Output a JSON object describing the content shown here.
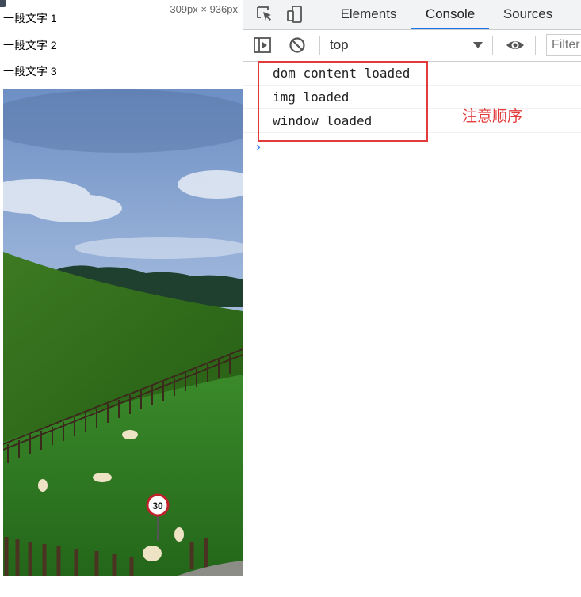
{
  "page": {
    "paragraphs": [
      "一段文字 1",
      "一段文字 2",
      "一段文字 3"
    ],
    "dimensions": "309px × 936px"
  },
  "devtools": {
    "tabs": [
      {
        "label": "Elements",
        "active": false
      },
      {
        "label": "Console",
        "active": true
      },
      {
        "label": "Sources",
        "active": false
      }
    ],
    "context_selector": "top",
    "filter_placeholder": "Filter"
  },
  "console": {
    "messages": [
      "dom content loaded",
      "img loaded",
      "window loaded"
    ],
    "prompt_symbol": "›"
  },
  "annotation": {
    "note": "注意顺序",
    "color": "#e23b3b"
  },
  "colors": {
    "accent": "#1a73e8",
    "toolbar_bg": "#f1f3f4",
    "border": "#cbcdd1"
  }
}
